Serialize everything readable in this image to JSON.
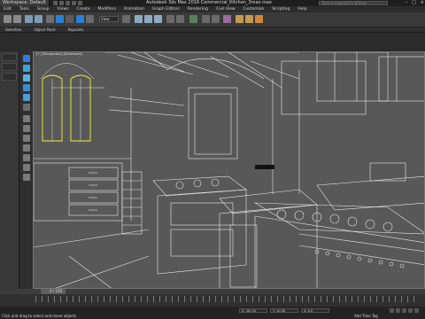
{
  "window": {
    "workspace": "Workspace: Default",
    "title": "Autodesk 3ds Max 2016    Commercial_Kitchen_3max.max",
    "search_placeholder": "Type a keyword or phrase",
    "minimize": "–",
    "maximize": "□",
    "close": "×"
  },
  "menu": [
    "Edit",
    "Tools",
    "Group",
    "Views",
    "Create",
    "Modifiers",
    "Animation",
    "Graph Editors",
    "Rendering",
    "Civil View",
    "Customize",
    "Scripting",
    "Help"
  ],
  "toolbar": {
    "view_selector": "View"
  },
  "ribbon": [
    "Selection",
    "Object Paint",
    "Populate"
  ],
  "viewport": {
    "label": "[+] [Perspective] [Wireframe]"
  },
  "timeline": {
    "frame_counter": "0 / 100"
  },
  "status": {
    "selection": "Click and drag to select and move objects",
    "x_value": "X: -89.34",
    "y_value": "Y: 10.58",
    "z_value": "Z: 0.0",
    "add_time_tag": "Add Time Tag"
  },
  "colors": {
    "viewport_bg": "#585858",
    "wire": "#e8e8e8",
    "selected": "#f0f040",
    "accent_blue": "#2a7fd8"
  }
}
